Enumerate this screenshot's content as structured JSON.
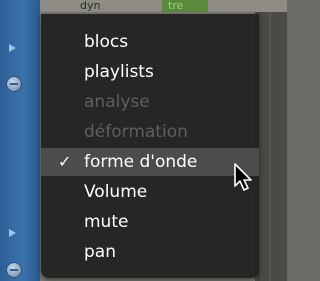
{
  "background": {
    "track_labels": [
      "dyn",
      "tre"
    ]
  },
  "context_menu": {
    "items": [
      {
        "label": "blocs",
        "enabled": true,
        "checked": false
      },
      {
        "label": "playlists",
        "enabled": true,
        "checked": false
      },
      {
        "label": "analyse",
        "enabled": false,
        "checked": false
      },
      {
        "label": "déformation",
        "enabled": false,
        "checked": false
      },
      {
        "label": "forme d'onde",
        "enabled": true,
        "checked": true,
        "highlighted": true
      },
      {
        "label": "Volume",
        "enabled": true,
        "checked": false
      },
      {
        "label": "mute",
        "enabled": true,
        "checked": false
      },
      {
        "label": "pan",
        "enabled": true,
        "checked": false
      }
    ],
    "check_glyph": "✓"
  },
  "colors": {
    "menu_bg": "#222221",
    "highlight": "#4c4c4b",
    "disabled_text": "#5f5f5e",
    "strip_blue": "#3a73ad"
  },
  "icons": [
    "play-arrow-icon",
    "collapse-circle-icon",
    "checkmark-icon",
    "mouse-pointer-icon"
  ]
}
